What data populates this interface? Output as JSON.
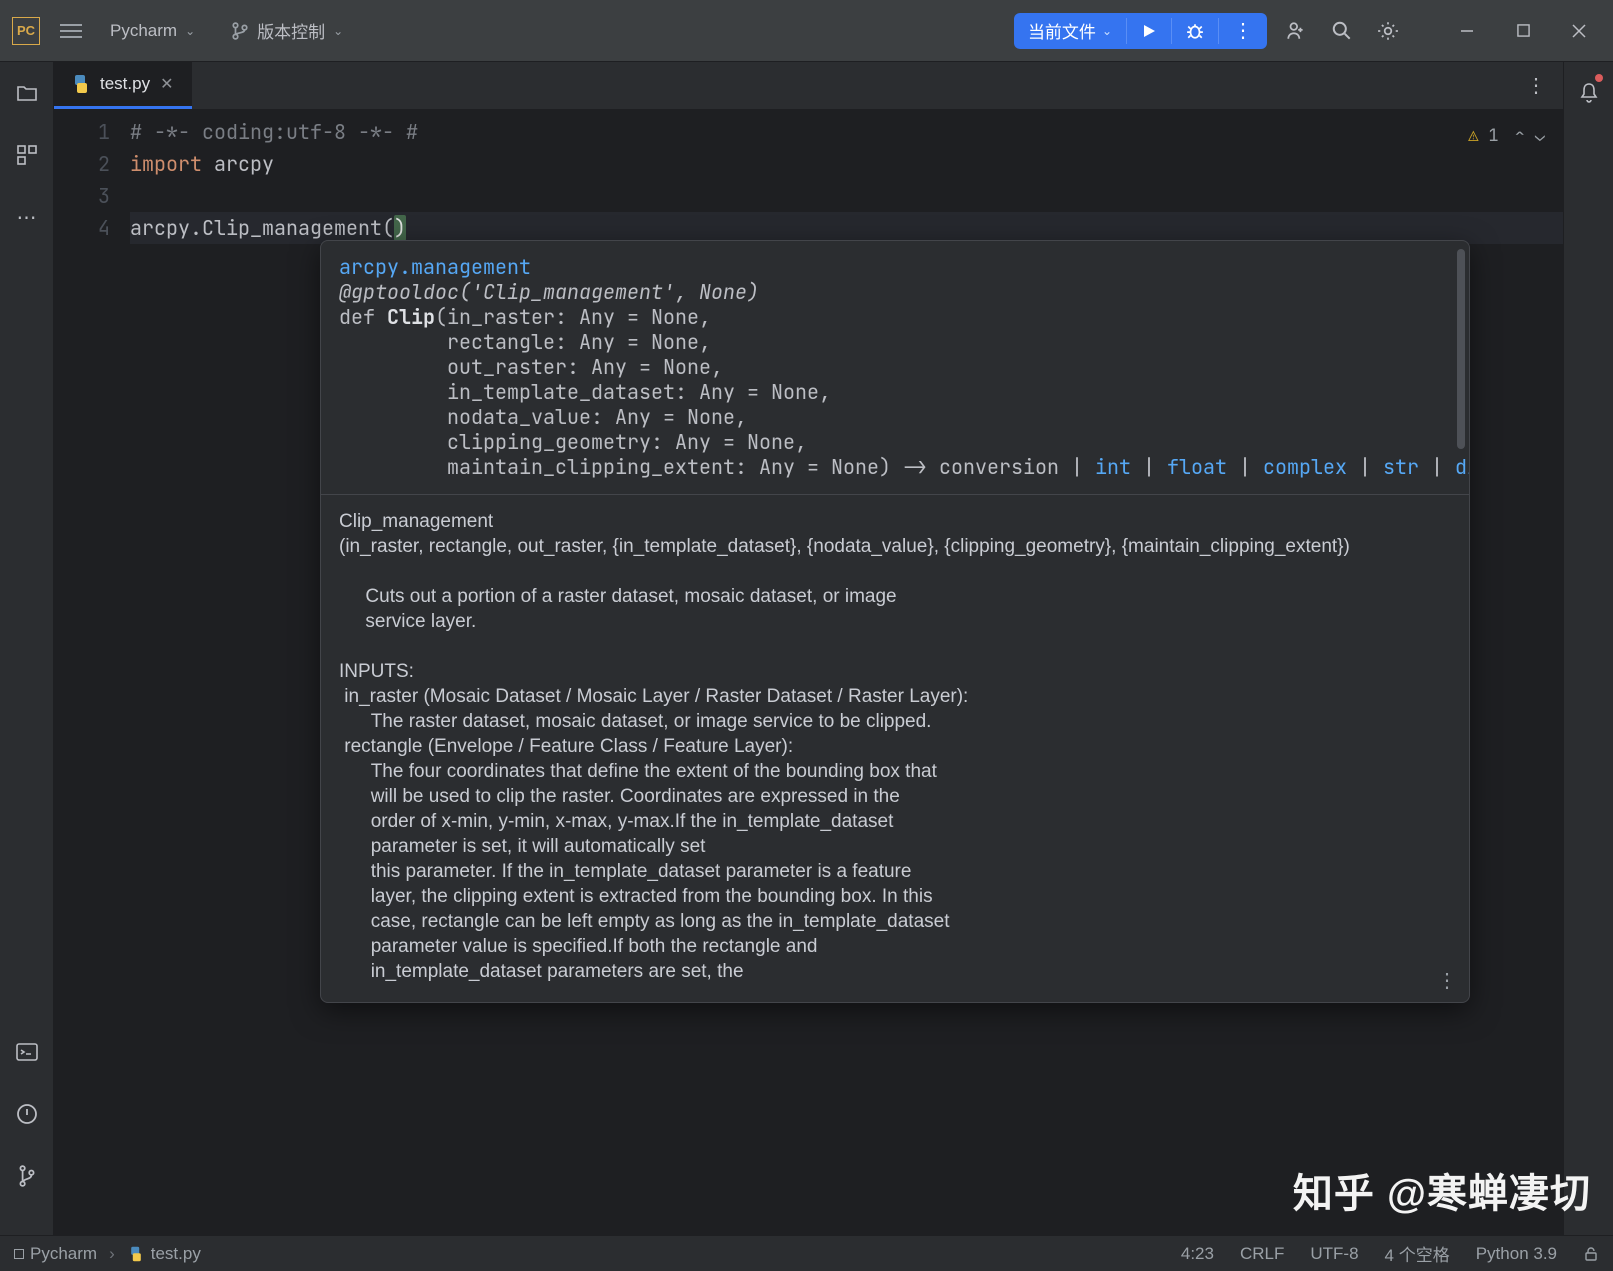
{
  "titlebar": {
    "app_logo_text": "PC",
    "project_name": "Pycharm",
    "vcs_label": "版本控制",
    "run_config_label": "当前文件"
  },
  "tabs": {
    "file": "test.py"
  },
  "editor": {
    "line_numbers": [
      "1",
      "2",
      "3",
      "4"
    ],
    "line1": "# -*- coding:utf-8 -*- #",
    "line2a": "import",
    "line2b": " arcpy",
    "line4a": "arcpy.Clip_management",
    "line4b": "(",
    "line4c": ")"
  },
  "insight": {
    "warn_count": "1"
  },
  "hint": {
    "module": "arcpy.management",
    "decorator": "@gptooldoc('Clip_management', None)",
    "sig_def": "def ",
    "sig_fn": "Clip",
    "sig_p1": "(in_raster: Any = None,",
    "sig_p2": "         rectangle: Any = None,",
    "sig_p3": "         out_raster: Any = None,",
    "sig_p4": "         in_template_dataset: Any = None,",
    "sig_p5": "         nodata_value: Any = None,",
    "sig_p6": "         clipping_geometry: Any = None,",
    "sig_p7a": "         maintain_clipping_extent: Any = None) -> conversion | ",
    "type_int": "int",
    "type_float": "float",
    "type_complex": "complex",
    "type_str": "str",
    "type_dict": "dict",
    "pipe": " | ",
    "doc_title": "Clip_management",
    "doc_sig": "(in_raster, rectangle, out_raster, {in_template_dataset}, {nodata_value}, {clipping_geometry}, {maintain_clipping_extent})",
    "doc_desc": "     Cuts out a portion of a raster dataset, mosaic dataset, or image\n     service layer.",
    "doc_inputs_label": "INPUTS:",
    "doc_inputs_body": " in_raster (Mosaic Dataset / Mosaic Layer / Raster Dataset / Raster Layer):\n      The raster dataset, mosaic dataset, or image service to be clipped.\n rectangle (Envelope / Feature Class / Feature Layer):\n      The four coordinates that define the extent of the bounding box that\n      will be used to clip the raster. Coordinates are expressed in the\n      order of x-min, y-min, x-max, y-max.If the in_template_dataset\n      parameter is set, it will automatically set\n      this parameter. If the in_template_dataset parameter is a feature\n      layer, the clipping extent is extracted from the bounding box. In this\n      case, rectangle can be left empty as long as the in_template_dataset\n      parameter value is specified.If both the rectangle and\n      in_template_dataset parameters are set, the"
  },
  "statusbar": {
    "crumb1": "Pycharm",
    "crumb2": "test.py",
    "cursor": "4:23",
    "line_sep": "CRLF",
    "encoding": "UTF-8",
    "indent": "4 个空格",
    "interpreter": "Python 3.9"
  },
  "watermark": "知乎 @寒蝉凄切"
}
